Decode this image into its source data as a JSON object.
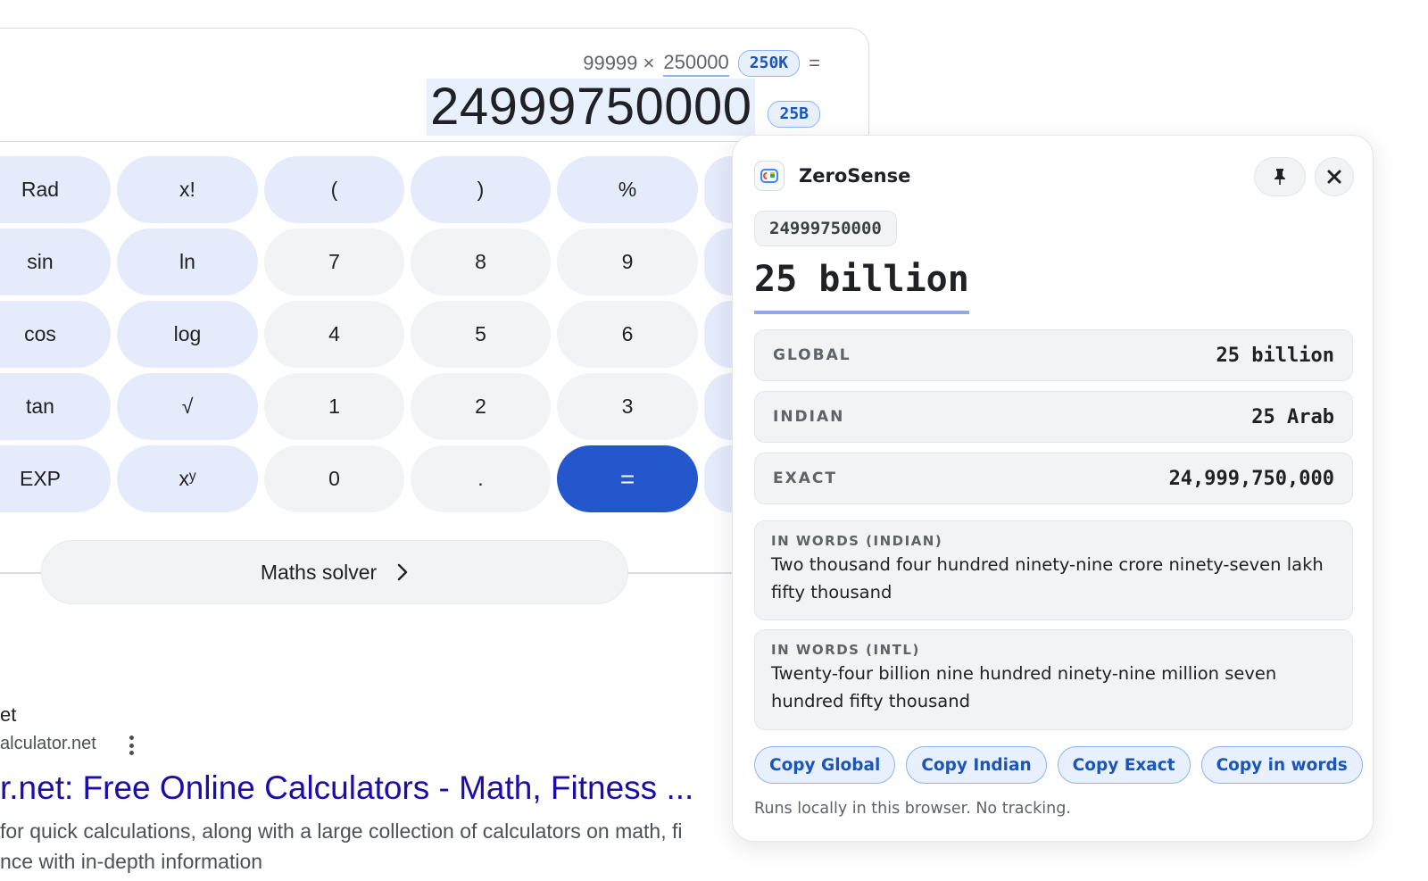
{
  "calculator": {
    "expression": {
      "operand1": "99999 ×",
      "operand2": "250000",
      "operand2_badge": "250K",
      "equals": "="
    },
    "result": {
      "value": "24999750000",
      "badge": "25B"
    },
    "keys": [
      [
        "Rad",
        "x!",
        "(",
        ")",
        "%"
      ],
      [
        "sin",
        "ln",
        "7",
        "8",
        "9"
      ],
      [
        "cos",
        "log",
        "4",
        "5",
        "6"
      ],
      [
        "tan",
        "√",
        "1",
        "2",
        "3"
      ],
      [
        "EXP",
        "xʸ",
        "0",
        ".",
        "="
      ]
    ],
    "solver_label": "Maths solver"
  },
  "search_result": {
    "site_name": "et",
    "url": "alculator.net",
    "title": "r.net: Free Online Calculators - Math, Fitness ...",
    "snippet": " for quick calculations, along with a large collection of calculators on math, fi",
    "snippet_line2": "nce with in-depth information"
  },
  "popup": {
    "app_name": "ZeroSense",
    "icons": {
      "app": "app-logo-icon",
      "pin": "pin-icon",
      "close": "close-icon"
    },
    "raw_value": "24999750000",
    "headline": "25 billion",
    "rows": [
      {
        "label": "GLOBAL",
        "value": "25 billion"
      },
      {
        "label": "INDIAN",
        "value": "25 Arab"
      },
      {
        "label": "EXACT",
        "value": "24,999,750,000"
      }
    ],
    "words_indian": {
      "label": "IN WORDS (INDIAN)",
      "text": "Two thousand four hundred ninety-nine crore ninety-seven lakh fifty thousand"
    },
    "words_intl": {
      "label": "IN WORDS (INTL)",
      "text": "Twenty-four billion nine hundred ninety-nine million seven hundred fifty thousand"
    },
    "buttons": {
      "copy_global": "Copy Global",
      "copy_indian": "Copy Indian",
      "copy_exact": "Copy Exact",
      "copy_words": "Copy in words"
    },
    "footnote": "Runs locally in this browser. No tracking."
  },
  "colors": {
    "accent": "#2457cc",
    "badge_bg": "#e8f0fe",
    "badge_text": "#1a56b8",
    "link": "#1a0dab"
  }
}
